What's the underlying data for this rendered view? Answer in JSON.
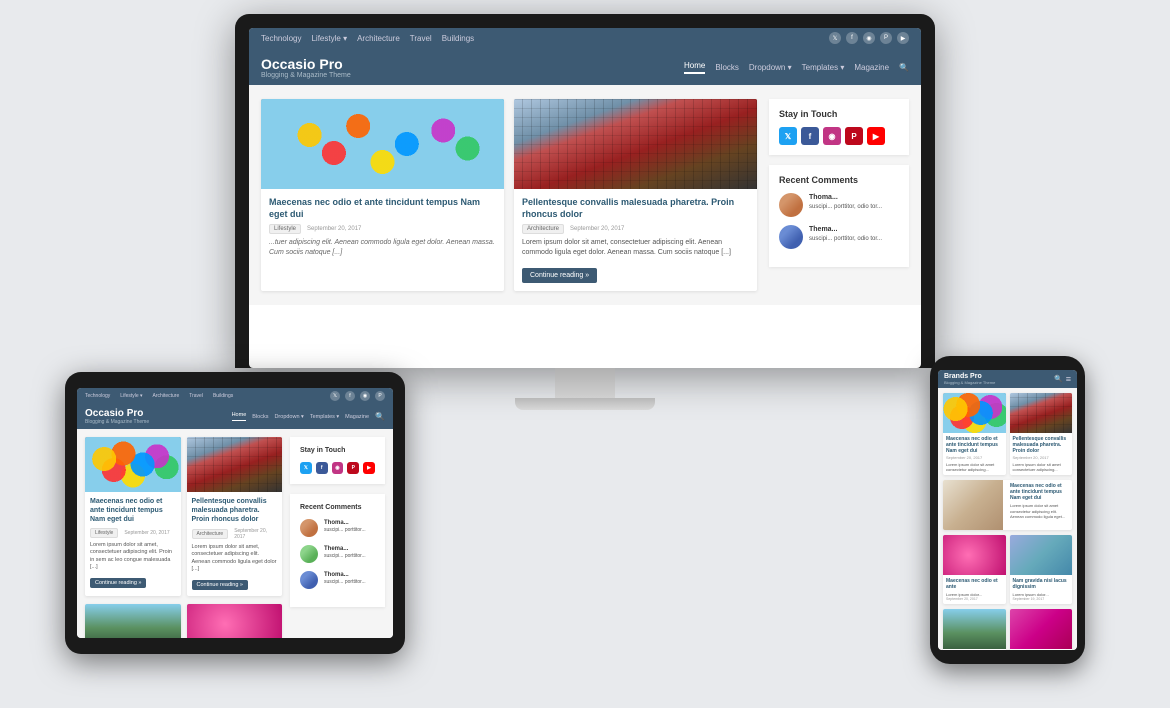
{
  "page": {
    "background": "#e8eaed"
  },
  "site": {
    "name": "Occasio Pro",
    "tagline": "Blogging & Magazine Theme",
    "nav_top_links": [
      "Technology",
      "Lifestyle",
      "Architecture",
      "Travel",
      "Buildings"
    ],
    "main_nav": [
      "Home",
      "Blocks",
      "Dropdown",
      "Templates",
      "Magazine"
    ],
    "post1": {
      "title": "Maecenas nec odio et ante tincidunt tempus Nam eget dui",
      "tag": "Lifestyle",
      "date": "September 20, 2017",
      "excerpt": "...tuer adipiscing elit. Aenean commodo ligula eget dolor. Aenean massa. Cum sociis natoque [...]"
    },
    "post2": {
      "title": "Pellentesque convallis malesuada pharetra. Proin rhoncus dolor",
      "tag": "Architecture",
      "date": "September 20, 2017",
      "excerpt": "Lorem ipsum dolor sit amet, consectetuer adipiscing elit. Aenean commodo ligula eget dolor. Aenean massa. Cum sociis natoque [...]",
      "continue_btn": "Continue reading »"
    },
    "sidebar": {
      "stay_in_touch": "Stay in Touch",
      "recent_comments": "Recent Comments",
      "social": [
        "twitter",
        "facebook",
        "instagram",
        "pinterest",
        "youtube"
      ],
      "comments": [
        {
          "name": "Thoma...",
          "text": "suscipi... porttitor, odio tor..."
        },
        {
          "name": "Thema...",
          "text": "suscipi... porttitor, odio tor..."
        }
      ]
    }
  },
  "icons": {
    "twitter": "𝕏",
    "facebook": "f",
    "instagram": "◉",
    "pinterest": "𝒫",
    "youtube": "▶",
    "search": "🔍",
    "hamburger": "≡"
  }
}
